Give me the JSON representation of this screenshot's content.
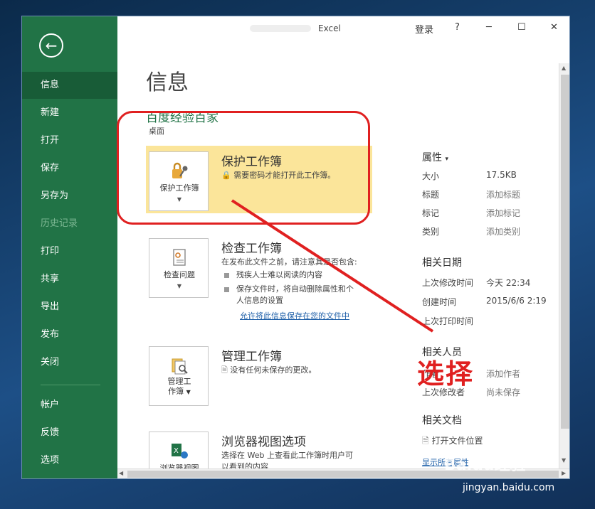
{
  "window": {
    "app_name": "Excel",
    "controls": {
      "login": "登录",
      "help": "?",
      "minimize": "─",
      "maximize": "☐",
      "close": "✕"
    }
  },
  "sidebar": {
    "back_icon": "back-arrow-icon",
    "items": [
      {
        "label": "信息",
        "active": true
      },
      {
        "label": "新建"
      },
      {
        "label": "打开"
      },
      {
        "label": "保存"
      },
      {
        "label": "另存为"
      },
      {
        "label": "历史记录",
        "disabled": true
      },
      {
        "label": "打印"
      },
      {
        "label": "共享"
      },
      {
        "label": "导出"
      },
      {
        "label": "发布"
      },
      {
        "label": "关闭"
      },
      {
        "label": "帐户"
      },
      {
        "label": "反馈"
      },
      {
        "label": "选项"
      }
    ]
  },
  "page": {
    "title": "信息",
    "file_name": "百度经验百家",
    "file_path": "桌面"
  },
  "cards": {
    "protect": {
      "button_label": "保护工作簿",
      "title": "保护工作簿",
      "desc": "需要密码才能打开此工作簿。"
    },
    "inspect": {
      "button_label": "检查问题",
      "title": "检查工作簿",
      "desc": "在发布此文件之前，请注意其是否包含:",
      "bullet1": "残疾人士难以阅读的内容",
      "bullet2a": "保存文件时，将自动删除属性和个",
      "bullet2b": "人信息的设置",
      "link": "允许将此信息保存在您的文件中"
    },
    "manage": {
      "button_label_1": "管理工",
      "button_label_2": "作簿",
      "title": "管理工作簿",
      "desc": "没有任何未保存的更改。"
    },
    "browser": {
      "button_label": "浏览器视图",
      "title": "浏览器视图选项",
      "desc1": "选择在 Web 上查看此工作簿时用户可",
      "desc2": "以看到的内容"
    }
  },
  "properties": {
    "head": "属性",
    "rows": [
      {
        "label": "大小",
        "value": "17.5KB"
      },
      {
        "label": "标题",
        "value": "添加标题"
      },
      {
        "label": "标记",
        "value": "添加标记"
      },
      {
        "label": "类别",
        "value": "添加类别"
      }
    ],
    "dates_head": "相关日期",
    "dates": [
      {
        "label": "上次修改时间",
        "value": "今天 22:34"
      },
      {
        "label": "创建时间",
        "value": "2015/6/6 2:19"
      },
      {
        "label": "上次打印时间",
        "value": ""
      }
    ],
    "people_head": "相关人员",
    "people": [
      {
        "label": "作者",
        "value": "添加作者"
      },
      {
        "label": "上次修改者",
        "value": "尚未保存"
      }
    ],
    "docs_head": "相关文档",
    "open_location": "打开文件位置",
    "show_all": "显示所有属性"
  },
  "annotation": {
    "callout": "选择",
    "color": "#e02020"
  },
  "watermark": {
    "brand": "Baidu经验",
    "url": "jingyan.baidu.com"
  }
}
